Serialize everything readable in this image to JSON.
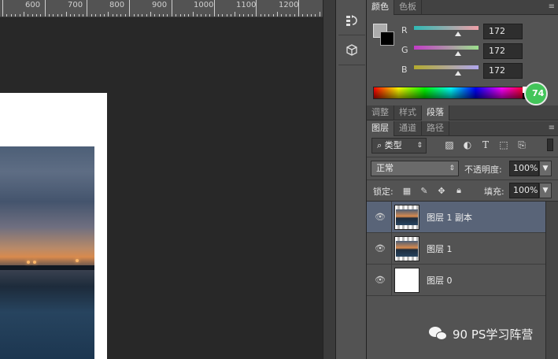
{
  "ruler": {
    "labels": [
      "600",
      "700",
      "800",
      "900",
      "1000",
      "1100",
      "1200"
    ]
  },
  "color_panel": {
    "tabs": [
      {
        "label": "颜色",
        "active": true
      },
      {
        "label": "色板",
        "active": false
      }
    ],
    "foreground_color": "#acacac",
    "background_color": "#000000",
    "channels": [
      {
        "label": "R",
        "value": "172",
        "gradient": [
          "#2fb9b4",
          "#f0a0a8"
        ]
      },
      {
        "label": "G",
        "value": "172",
        "gradient": [
          "#c33cc7",
          "#9be08c"
        ]
      },
      {
        "label": "B",
        "value": "172",
        "gradient": [
          "#b3aa2e",
          "#b0a6ee"
        ]
      }
    ],
    "badge": "74"
  },
  "adjust_panel": {
    "tabs": [
      {
        "label": "调整",
        "active": false
      },
      {
        "label": "样式",
        "active": false
      },
      {
        "label": "段落",
        "active": true
      }
    ]
  },
  "layers_panel": {
    "tabs": [
      {
        "label": "图层",
        "active": true
      },
      {
        "label": "通道",
        "active": false
      },
      {
        "label": "路径",
        "active": false
      }
    ],
    "filter_type": "类型",
    "blend_mode": "正常",
    "opacity_label": "不透明度:",
    "opacity_value": "100%",
    "lock_label": "锁定:",
    "fill_label": "填充:",
    "fill_value": "100%",
    "layers": [
      {
        "name": "图层 1 副本",
        "thumb": "checker",
        "selected": true
      },
      {
        "name": "图层 1",
        "thumb": "photo",
        "selected": false
      },
      {
        "name": "图层 0",
        "thumb": "white",
        "selected": false
      }
    ]
  },
  "watermark": {
    "text": "90 PS学习阵营"
  }
}
